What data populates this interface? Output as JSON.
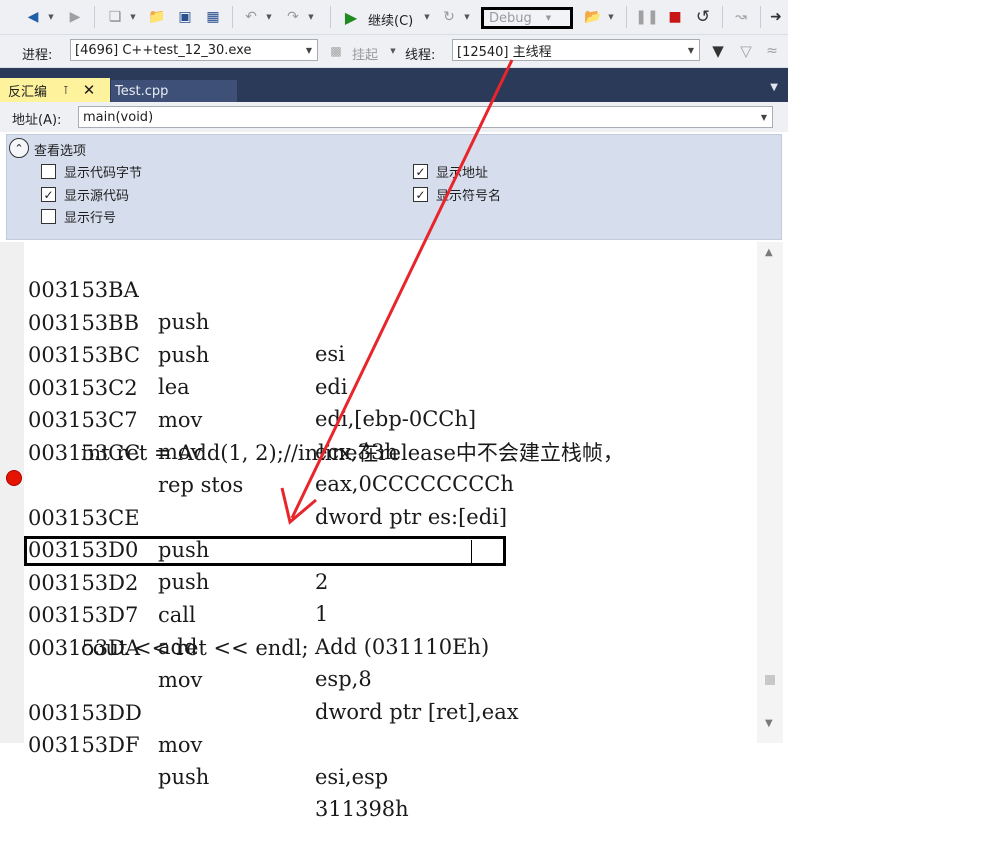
{
  "toolbar": {
    "continue_label": "继续(C)",
    "config_value": "Debug"
  },
  "debugbar": {
    "process_label": "进程:",
    "process_value": "[4696] C++test_12_30.exe",
    "suspend_label": "挂起",
    "thread_label": "线程:",
    "thread_value": "[12540] 主线程"
  },
  "tabs": [
    {
      "label": "反汇编",
      "active": true
    },
    {
      "label": "Test.cpp",
      "active": false
    }
  ],
  "address": {
    "label": "地址(A):",
    "value": "main(void)"
  },
  "view_options": {
    "title": "查看选项",
    "items": [
      {
        "label": "显示代码字节",
        "checked": false
      },
      {
        "label": "显示源代码",
        "checked": true
      },
      {
        "label": "显示行号",
        "checked": false
      },
      {
        "label": "显示地址",
        "checked": true
      },
      {
        "label": "显示符号名",
        "checked": true
      }
    ]
  },
  "code_lines": [
    {
      "addr": "003153BA",
      "mnem": "push",
      "ops": "esi"
    },
    {
      "addr": "003153BB",
      "mnem": "push",
      "ops": "edi"
    },
    {
      "addr": "003153BC",
      "mnem": "lea",
      "ops": "edi,[ebp-0CCh]"
    },
    {
      "addr": "003153C2",
      "mnem": "mov",
      "ops": "ecx,33h"
    },
    {
      "addr": "003153C7",
      "mnem": "mov",
      "ops": "eax,0CCCCCCCCh"
    },
    {
      "addr": "003153CC",
      "mnem": "rep stos",
      "ops": "dword ptr es:[edi]"
    },
    {
      "src": "int ret = Add(1, 2);//inline在release中不会建立栈帧，"
    },
    {
      "addr": "003153CE",
      "mnem": "push",
      "ops": "2",
      "breakpoint": true
    },
    {
      "addr": "003153D0",
      "mnem": "push",
      "ops": "1"
    },
    {
      "addr": "003153D2",
      "mnem": "call",
      "ops": "Add (031110Eh)",
      "highlighted": true
    },
    {
      "addr": "003153D7",
      "mnem": "add",
      "ops": "esp,8"
    },
    {
      "addr": "003153DA",
      "mnem": "mov",
      "ops": "dword ptr [ret],eax"
    },
    {
      "src": "cout << ret << endl;"
    },
    {
      "addr": "003153DD",
      "mnem": "mov",
      "ops": "esi,esp"
    },
    {
      "addr": "003153DF",
      "mnem": "push",
      "ops": "311398h"
    }
  ],
  "colors": {
    "tab_active": "#fff29d",
    "tabstrip": "#2b3a59",
    "breakpoint": "#e51400",
    "annotation_arrow": "#e8252a",
    "play": "#1f8a1f",
    "stop": "#c81616"
  }
}
